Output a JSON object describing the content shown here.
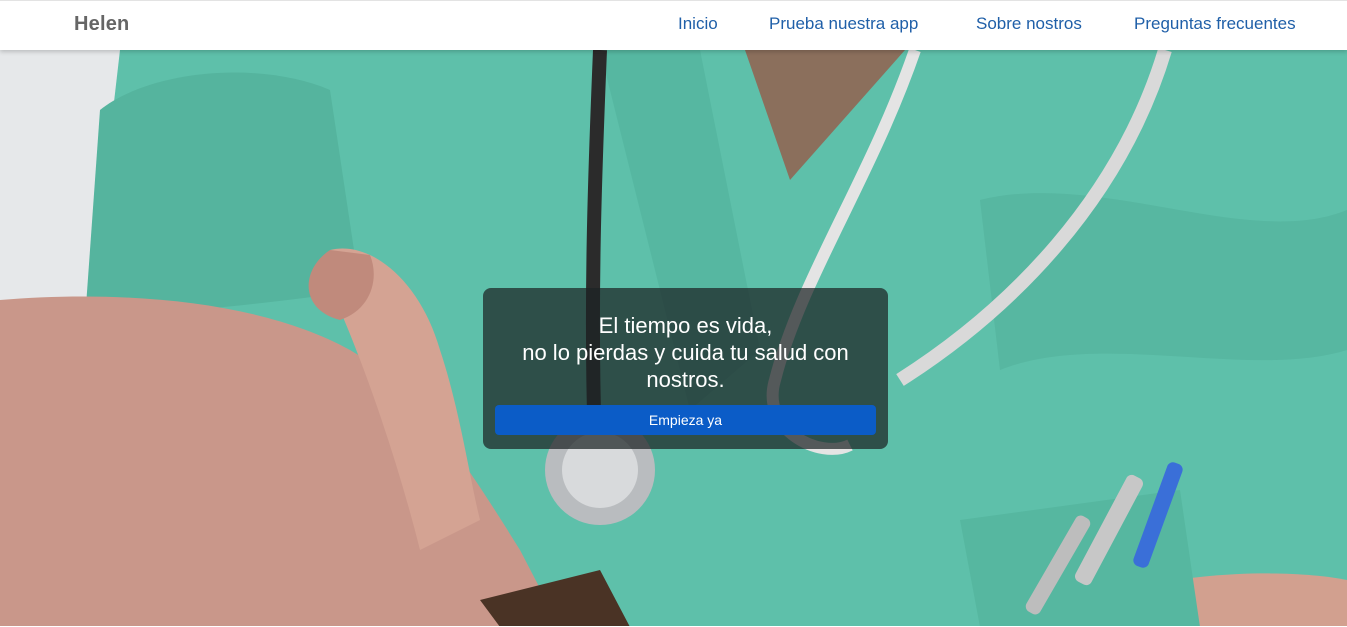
{
  "navbar": {
    "brand": "Helen",
    "links": [
      {
        "label": "Inicio"
      },
      {
        "label": "Prueba nuestra app"
      },
      {
        "label": "Sobre nostros"
      },
      {
        "label": "Preguntas frecuentes"
      }
    ]
  },
  "hero": {
    "image": "doctor-in-green-scrubs-with-stethoscope-photo",
    "headline_lines": [
      "El tiempo es vida,",
      "no lo pierdas y cuida tu salud con",
      "nostros."
    ],
    "cta_label": "Empieza ya"
  },
  "colors": {
    "nav_link": "#1f5fa8",
    "brand": "#666666",
    "cta": "#0b5cc7",
    "scrubs": "#5ec0aa"
  }
}
